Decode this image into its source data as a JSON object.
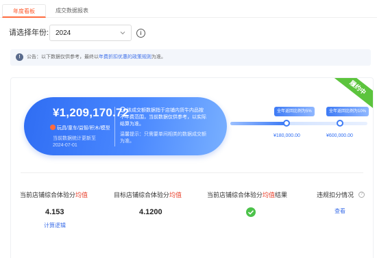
{
  "tabs": [
    {
      "label": "年度看板",
      "active": true
    },
    {
      "label": "成交数据报表",
      "active": false
    }
  ],
  "year_filter": {
    "label": "请选择年份:",
    "selected": "2024",
    "info_icon": "info-icon"
  },
  "notice": {
    "prefix": "公告：以下数据仅供参考，最终以",
    "link": "年费折扣优惠的政策规则",
    "suffix": "为准。"
  },
  "card": {
    "ribbon": "履约中",
    "amount": "¥1,209,170.72",
    "categories": "玩具/童车/益智/积木/模型",
    "update_line1": "当前数据统计更新至",
    "update_line2": "2024-07-01",
    "description": "该成交额数据指于店铺内货牛内品按不年费范围，当前数据仅供参考，以实际结算为准。",
    "hint": "温馨提示：只需要单间相类的数据成交额为准。",
    "milestones": [
      {
        "label": "全年返回比例为5%",
        "value": "¥180,000.00"
      },
      {
        "label": "全年返回比例为10%",
        "value": "¥600,000.00"
      }
    ],
    "progress": 0.4
  },
  "metrics": [
    {
      "label": "当前店铺综合体验分",
      "highlight": "均值",
      "value": "4.153",
      "link": "计算逻辑"
    },
    {
      "label": "目标店铺综合体验分",
      "highlight": "均值",
      "value": "4.1200"
    },
    {
      "label": "当前店铺综合体验分",
      "highlight": "均值",
      "suffix": "结果",
      "status": "passed"
    },
    {
      "label": "违规扣分情况",
      "link": "查看"
    }
  ],
  "colors": {
    "accent": "#ff5a2c",
    "primary_blue": "#2f6df3",
    "success": "#4cc24a",
    "highlight_red": "#e8412c"
  }
}
